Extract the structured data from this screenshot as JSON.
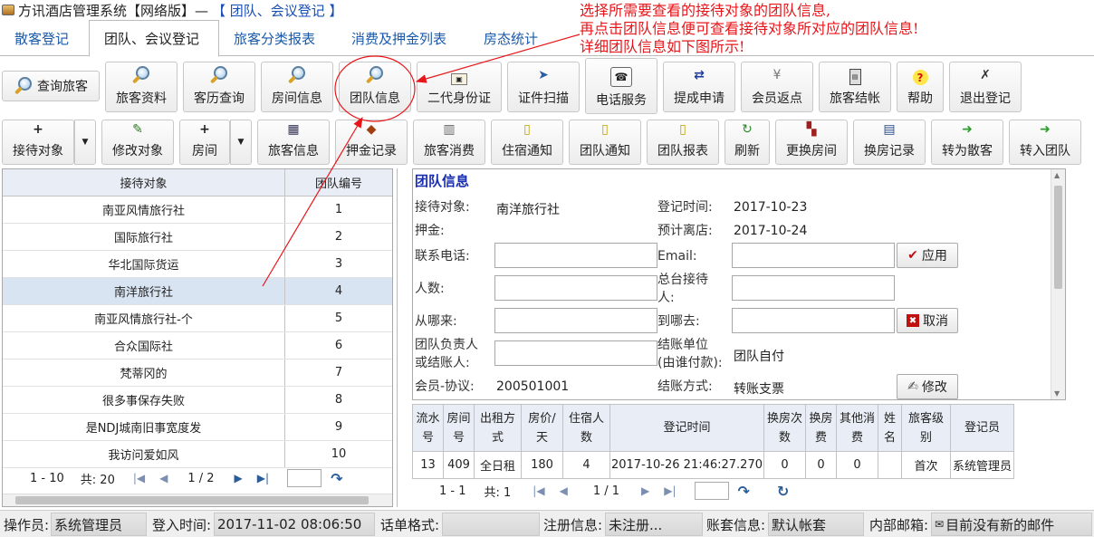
{
  "window": {
    "title": "方讯酒店管理系统【网络版】—",
    "module": "【 团队、会议登记 】"
  },
  "tabs": [
    {
      "label": "散客登记"
    },
    {
      "label": "团队、会议登记"
    },
    {
      "label": "旅客分类报表"
    },
    {
      "label": "消费及押金列表"
    },
    {
      "label": "房态统计"
    }
  ],
  "toolbar1": [
    {
      "label": "查询旅客",
      "icon": "magnifier-icon"
    },
    {
      "label": "旅客资料",
      "icon": "magnifier-icon"
    },
    {
      "label": "客历查询",
      "icon": "magnifier-icon"
    },
    {
      "label": "房间信息",
      "icon": "magnifier-icon"
    },
    {
      "label": "团队信息",
      "icon": "magnifier-icon"
    },
    {
      "label": "二代身份证",
      "icon": "id-card-icon"
    },
    {
      "label": "证件扫描",
      "icon": "scanner-icon"
    },
    {
      "label": "电话服务",
      "icon": "phone-icon"
    },
    {
      "label": "提成申请",
      "icon": "transfer-icon"
    },
    {
      "label": "会员返点",
      "icon": "yen-icon"
    },
    {
      "label": "旅客结帐",
      "icon": "calculator-icon"
    },
    {
      "label": "帮助",
      "icon": "help-icon"
    },
    {
      "label": "退出登记",
      "icon": "exit-icon"
    }
  ],
  "toolbar2": [
    {
      "label": "接待对象",
      "icon": "plus-icon"
    },
    {
      "label": "修改对象",
      "icon": "edit-icon"
    },
    {
      "label": "房间",
      "icon": "plus-icon"
    },
    {
      "label": "旅客信息",
      "icon": "info-icon"
    },
    {
      "label": "押金记录",
      "icon": "deposit-icon"
    },
    {
      "label": "旅客消费",
      "icon": "consume-icon"
    },
    {
      "label": "住宿通知",
      "icon": "notice-icon"
    },
    {
      "label": "团队通知",
      "icon": "notice-icon"
    },
    {
      "label": "团队报表",
      "icon": "report-icon"
    },
    {
      "label": "刷新",
      "icon": "refresh-icon"
    },
    {
      "label": "更换房间",
      "icon": "room-change-icon"
    },
    {
      "label": "换房记录",
      "icon": "record-icon"
    },
    {
      "label": "转为散客",
      "icon": "arrow-right-icon"
    },
    {
      "label": "转入团队",
      "icon": "arrow-right-icon"
    }
  ],
  "left_grid": {
    "columns": [
      "接待对象",
      "团队编号"
    ],
    "rows": [
      [
        "南亚风情旅行社",
        "1"
      ],
      [
        "国际旅行社",
        "2"
      ],
      [
        "华北国际货运",
        "3"
      ],
      [
        "南洋旅行社",
        "4"
      ],
      [
        "南亚风情旅行社-个",
        "5"
      ],
      [
        "合众国际社",
        "6"
      ],
      [
        "梵蒂冈的",
        "7"
      ],
      [
        "很多事保存失败",
        "8"
      ],
      [
        "是NDJ城南旧事宽度发",
        "9"
      ],
      [
        "我访问爱如风",
        "10"
      ]
    ],
    "selected_index": 3,
    "pager": {
      "range": "1 - 10",
      "total": "共: 20",
      "page": "1 / 2"
    }
  },
  "detail": {
    "title": "团队信息",
    "labels": {
      "reception": "接待对象:",
      "deposit": "押金:",
      "phone": "联系电话:",
      "people": "人数:",
      "from": "从哪来:",
      "leader": "团队负责人\n或结账人:",
      "member": "会员-协议:",
      "register_time": "登记时间:",
      "depart": "预计离店:",
      "email": "Email:",
      "front_desk": "总台接待\n人:",
      "to": "到哪去:",
      "payer": "结账单位\n(由谁付款):",
      "pay_method": "结账方式:"
    },
    "values": {
      "reception": "南洋旅行社",
      "register_time": "2017-10-23",
      "depart": "2017-10-24",
      "payer": "团队自付",
      "member": "200501001",
      "pay_method": "转账支票"
    },
    "buttons": {
      "apply": "应用",
      "cancel": "取消",
      "modify": "修改"
    }
  },
  "room_table": {
    "columns": [
      "流水\n号",
      "房间\n号",
      "出租方\n式",
      "房价/\n天",
      "住宿人\n数",
      "登记时间",
      "换房次\n数",
      "换房\n费",
      "其他消\n费",
      "姓\n名",
      "旅客级\n别",
      "登记员"
    ],
    "rows": [
      [
        "13",
        "409",
        "全日租",
        "180",
        "4",
        "2017-10-26 21:46:27.270",
        "0",
        "0",
        "0",
        "",
        "首次",
        "系统管理员"
      ]
    ],
    "pager": {
      "range": "1 - 1",
      "total": "共: 1",
      "page": "1 / 1"
    }
  },
  "statusbar": {
    "operator_label": "操作员:",
    "operator": "系统管理员",
    "login_label": "登入时间:",
    "login": "2017-11-02 08:06:50",
    "format_label": "话单格式:",
    "format": "",
    "reg_label": "注册信息:",
    "reg": "未注册...",
    "account_label": "账套信息:",
    "account": "默认帐套",
    "mail_label": "内部邮箱:",
    "mail": "目前没有新的邮件"
  },
  "annotation": {
    "text": "选择所需要查看的接待对象的团队信息,\n再点击团队信息便可查看接待对象所对应的团队信息!\n详细团队信息如下图所示!",
    "color": "#e8161a"
  }
}
